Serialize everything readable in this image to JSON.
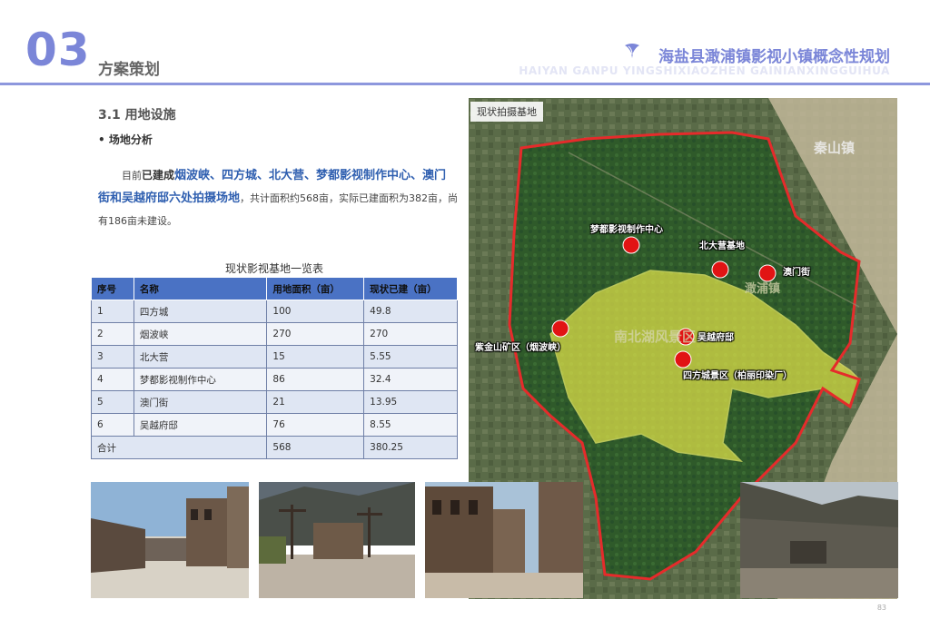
{
  "header": {
    "section_number": "03",
    "section_title": "方案策划",
    "project_title": "海盐县澉浦镇影视小镇概念性规划",
    "project_subtitle": "HAIYAN GANPU YINGSHIXIAOZHEN GAINIANXINGGUIHUA",
    "logo_icon": "leaf-logo-icon"
  },
  "content": {
    "subheading": "3.1  用地设施",
    "bullet": "• 场地分析",
    "para_lead": "目前",
    "para_bold": "已建成",
    "para_blue": "烟波峡、四方城、北大营、梦都影视制作中心、澳门街和吴越府邸六处拍摄场地",
    "para_rest": "，共计面积约568亩，实际已建面积为382亩，尚有186亩未建设。"
  },
  "table": {
    "title": "现状影视基地一览表",
    "headers": [
      "序号",
      "名称",
      "用地面积（亩）",
      "现状已建（亩）"
    ],
    "rows": [
      [
        "1",
        "四方城",
        "100",
        "49.8"
      ],
      [
        "2",
        "烟波峡",
        "270",
        "270"
      ],
      [
        "3",
        "北大营",
        "15",
        "5.55"
      ],
      [
        "4",
        "梦都影视制作中心",
        "86",
        "32.4"
      ],
      [
        "5",
        "澳门街",
        "21",
        "13.95"
      ],
      [
        "6",
        "吴越府邸",
        "76",
        "8.55"
      ]
    ],
    "total_label": "合计",
    "total_area": "568",
    "total_built": "380.25"
  },
  "map": {
    "tag": "现状拍摄基地",
    "town_label": "秦山镇",
    "area_label": "南北湖风景区",
    "ganpu_label": "澉浦镇",
    "markers": {
      "mengdu": "梦都影视制作中心",
      "beidaying": "北大营基地",
      "aomenjie": "澳门街",
      "zijinshan": "紫金山矿区（烟波峡）",
      "wuyue": "吴越府邸",
      "sifang": "四方城景区（柏丽印染厂）"
    },
    "colors": {
      "boundary": "#e52b2b",
      "scenic": "#e6e64a",
      "marker": "#e11414"
    }
  },
  "photos": [
    "western-street-photo",
    "western-town-photo",
    "western-buildings-photo",
    "quarry-photo"
  ],
  "page_number": "83"
}
